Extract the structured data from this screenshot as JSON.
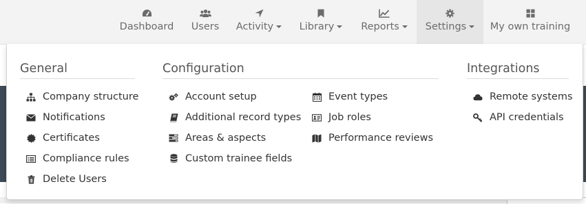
{
  "nav": {
    "items": [
      {
        "label": "Dashboard",
        "icon": "dashboard-icon",
        "caret": false
      },
      {
        "label": "Users",
        "icon": "users-icon",
        "caret": false
      },
      {
        "label": "Activity",
        "icon": "location-arrow-icon",
        "caret": true
      },
      {
        "label": "Library",
        "icon": "bookmark-icon",
        "caret": true
      },
      {
        "label": "Reports",
        "icon": "line-chart-icon",
        "caret": true
      },
      {
        "label": "Settings",
        "icon": "gear-icon",
        "caret": true,
        "active": true
      },
      {
        "label": "My own training",
        "icon": "grid-icon",
        "caret": false
      }
    ]
  },
  "dropdown": {
    "general": {
      "title": "General",
      "items": [
        {
          "label": "Company structure",
          "icon": "sitemap-icon"
        },
        {
          "label": "Notifications",
          "icon": "envelope-icon"
        },
        {
          "label": "Certificates",
          "icon": "certificate-icon"
        },
        {
          "label": "Compliance rules",
          "icon": "list-alt-icon"
        },
        {
          "label": "Delete Users",
          "icon": "trash-icon"
        }
      ]
    },
    "configuration": {
      "title": "Configuration",
      "items": [
        {
          "label": "Account setup",
          "icon": "cogs-icon"
        },
        {
          "label": "Additional record types",
          "icon": "book-icon"
        },
        {
          "label": "Areas & aspects",
          "icon": "tasks-icon"
        },
        {
          "label": "Custom trainee fields",
          "icon": "database-icon"
        },
        {
          "label": "Event types",
          "icon": "calendar-icon"
        },
        {
          "label": "Job roles",
          "icon": "id-card-icon"
        },
        {
          "label": "Performance reviews",
          "icon": "map-icon"
        }
      ]
    },
    "integrations": {
      "title": "Integrations",
      "items": [
        {
          "label": "Remote systems",
          "icon": "cloud-icon"
        },
        {
          "label": "API credentials",
          "icon": "key-icon"
        }
      ]
    }
  },
  "colors": {
    "nav_bg": "#f3f3f3",
    "nav_text": "#6b6b6b",
    "active_bg": "#e6e6e6",
    "menu_text": "#333333",
    "dark_strip": "#3d4a57"
  }
}
